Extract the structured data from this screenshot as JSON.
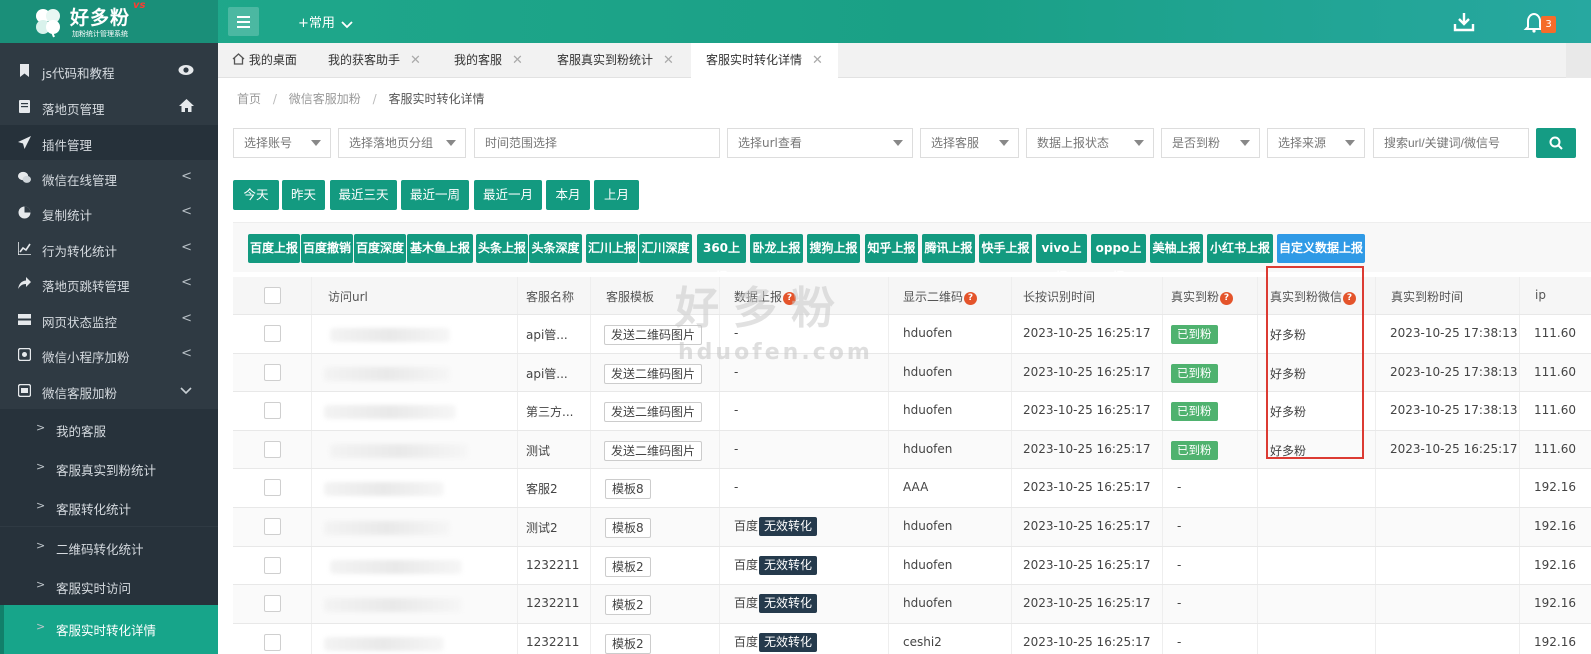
{
  "app": {
    "logo_text": "好多粉",
    "logo_vs": "vs",
    "logo_sub": "加粉统计管理系统",
    "common_menu": "+常用",
    "notification_count": "3"
  },
  "sidebar": {
    "items": [
      {
        "label": "js代码和教程",
        "icon": "bookmark-icon",
        "right_icon": "eye-icon"
      },
      {
        "label": "落地页管理",
        "icon": "doc-icon",
        "right_icon": "home-icon"
      },
      {
        "label": "插件管理",
        "icon": "paper-plane-icon"
      },
      {
        "label": "微信在线管理",
        "icon": "wechat-icon",
        "arrow": "<"
      },
      {
        "label": "复制统计",
        "icon": "pie-icon",
        "arrow": "<"
      },
      {
        "label": "行为转化统计",
        "icon": "line-chart-icon",
        "arrow": "<"
      },
      {
        "label": "落地页跳转管理",
        "icon": "share-icon",
        "arrow": "<"
      },
      {
        "label": "网页状态监控",
        "icon": "server-icon",
        "arrow": "<"
      },
      {
        "label": "微信小程序加粉",
        "icon": "mini-program-icon",
        "arrow": "<"
      },
      {
        "label": "微信客服加粉",
        "icon": "customer-icon",
        "arrow": "v"
      }
    ],
    "sub_items": [
      {
        "label": "我的客服"
      },
      {
        "label": "客服真实到粉统计"
      },
      {
        "label": "客服转化统计"
      },
      {
        "label": "二维码转化统计"
      },
      {
        "label": "客服实时访问"
      },
      {
        "label": "客服实时转化详情"
      }
    ]
  },
  "tabs": [
    {
      "label": "我的桌面"
    },
    {
      "label": "我的获客助手"
    },
    {
      "label": "我的客服"
    },
    {
      "label": "客服真实到粉统计"
    },
    {
      "label": "客服实时转化详情"
    }
  ],
  "breadcrumb": {
    "home": "首页",
    "parent": "微信客服加粉",
    "current": "客服实时转化详情",
    "sep": "/"
  },
  "filters": [
    {
      "label": "选择账号"
    },
    {
      "label": "选择落地页分组"
    },
    {
      "label": "时间范围选择"
    },
    {
      "label": "选择url查看"
    },
    {
      "label": "选择客服"
    },
    {
      "label": "数据上报状态"
    },
    {
      "label": "是否到粉"
    },
    {
      "label": "选择来源"
    }
  ],
  "search": {
    "placeholder": "搜索url/关键词/微信号"
  },
  "date_buttons": [
    "今天",
    "昨天",
    "最近三天",
    "最近一周",
    "最近一月",
    "本月",
    "上月"
  ],
  "report_buttons": [
    "百度上报",
    "百度撤销",
    "百度深度",
    "基木鱼上报",
    "头条上报",
    "头条深度",
    "汇川上报",
    "汇川深度",
    "360上报",
    "卧龙上报",
    "搜狗上报",
    "知乎上报",
    "腾讯上报",
    "快手上报",
    "vivo上报",
    "oppo上报",
    "美柚上报",
    "小红书上报",
    "自定义数据上报"
  ],
  "table": {
    "headers": [
      "访问url",
      "客服名称",
      "客服模板",
      "数据上报",
      "显示二维码",
      "长按识别时间",
      "真实到粉",
      "真实到粉微信",
      "真实到粉时间",
      "ip"
    ],
    "rows": [
      {
        "name": "api管...",
        "template": "发送二维码图片",
        "report": "-",
        "report_tag": "",
        "qr": "hduofen",
        "press_time": "2023-10-25 16:25:17",
        "real": "已到粉",
        "wechat": "好多粉",
        "real_time": "2023-10-25 17:38:13",
        "ip": "111.60"
      },
      {
        "name": "api管...",
        "template": "发送二维码图片",
        "report": "-",
        "report_tag": "",
        "qr": "hduofen",
        "press_time": "2023-10-25 16:25:17",
        "real": "已到粉",
        "wechat": "好多粉",
        "real_time": "2023-10-25 17:38:13",
        "ip": "111.60"
      },
      {
        "name": "第三方...",
        "template": "发送二维码图片",
        "report": "-",
        "report_tag": "",
        "qr": "hduofen",
        "press_time": "2023-10-25 16:25:17",
        "real": "已到粉",
        "wechat": "好多粉",
        "real_time": "2023-10-25 17:38:13",
        "ip": "111.60"
      },
      {
        "name": "测试",
        "template": "发送二维码图片",
        "report": "-",
        "report_tag": "",
        "qr": "hduofen",
        "press_time": "2023-10-25 16:25:17",
        "real": "已到粉",
        "wechat": "好多粉",
        "real_time": "2023-10-25 16:25:17",
        "ip": "111.60"
      },
      {
        "name": "客服2",
        "template": "模板8",
        "report": "-",
        "report_tag": "",
        "qr": "AAA",
        "press_time": "2023-10-25 16:25:17",
        "real": "-",
        "wechat": "",
        "real_time": "",
        "ip": "192.16"
      },
      {
        "name": "测试2",
        "template": "模板8",
        "report": "百度",
        "report_tag": "无效转化",
        "qr": "hduofen",
        "press_time": "2023-10-25 16:25:17",
        "real": "-",
        "wechat": "",
        "real_time": "",
        "ip": "192.16"
      },
      {
        "name": "1232211",
        "template": "模板2",
        "report": "百度",
        "report_tag": "无效转化",
        "qr": "hduofen",
        "press_time": "2023-10-25 16:25:17",
        "real": "-",
        "wechat": "",
        "real_time": "",
        "ip": "192.16"
      },
      {
        "name": "1232211",
        "template": "模板2",
        "report": "百度",
        "report_tag": "无效转化",
        "qr": "hduofen",
        "press_time": "2023-10-25 16:25:17",
        "real": "-",
        "wechat": "",
        "real_time": "",
        "ip": "192.16"
      },
      {
        "name": "1232211",
        "template": "模板2",
        "report": "百度",
        "report_tag": "无效转化",
        "qr": "ceshi2",
        "press_time": "2023-10-25 16:25:17",
        "real": "-",
        "wechat": "",
        "real_time": "",
        "ip": "192.16"
      }
    ]
  },
  "watermark": {
    "main": "好多粉",
    "sub": "hduofen.com"
  },
  "colors": {
    "brand": "#17a58a",
    "sidebar_bg": "#2f3a43",
    "highlight_border": "#dc3b33",
    "custom_report": "#2f9ae6"
  }
}
